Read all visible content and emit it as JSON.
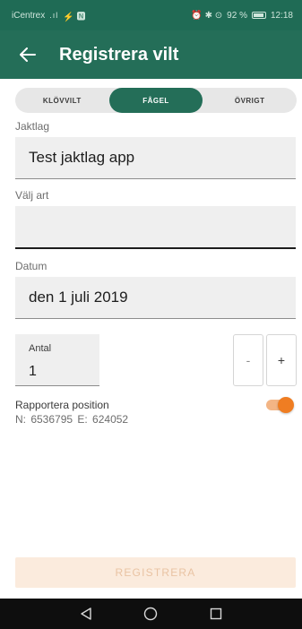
{
  "status_bar": {
    "carrier": "iCentrex",
    "signal": ".ıl",
    "extra_icons": "⚡ 🅽",
    "right_icons": "⏰ ✱ ⊙",
    "battery": "92 %",
    "time": "12:18"
  },
  "app_bar": {
    "back_icon": "arrow-left-icon",
    "title": "Registrera vilt"
  },
  "tabs": [
    {
      "label": "KLÖVVILT",
      "active": false
    },
    {
      "label": "FÅGEL",
      "active": true
    },
    {
      "label": "ÖVRIGT",
      "active": false
    }
  ],
  "form": {
    "jaktlag_label": "Jaktlag",
    "jaktlag_value": "Test jaktlag app",
    "art_label": "Välj art",
    "art_value": "",
    "datum_label": "Datum",
    "datum_value": "den 1 juli 2019",
    "antal_label": "Antal",
    "antal_value": "1",
    "minus_label": "-",
    "plus_label": "+"
  },
  "position": {
    "title": "Rapportera position",
    "coords": "N: 6536795  E: 624052",
    "enabled": true
  },
  "register_button": "REGISTRERA",
  "colors": {
    "primary": "#246e58",
    "status": "#1f6b55",
    "accent": "#ef7d22",
    "button_disabled_bg": "#fbebdd",
    "button_disabled_text": "#e9c3a3"
  },
  "nav": [
    "back-triangle-icon",
    "home-circle-icon",
    "recents-square-icon"
  ]
}
